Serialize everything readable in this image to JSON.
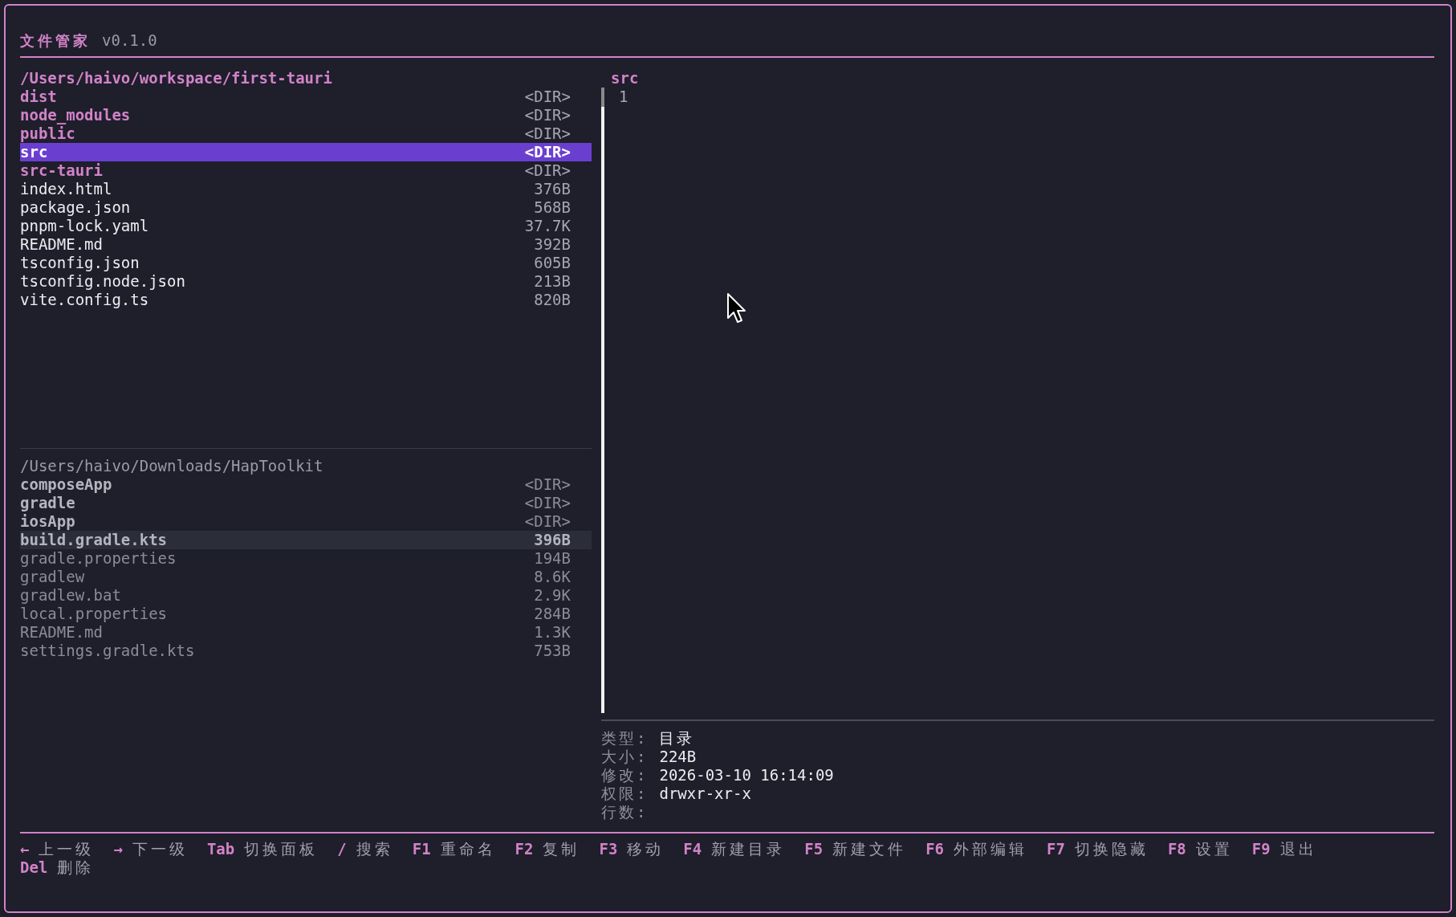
{
  "header": {
    "title": "文件管家",
    "version": "v0.1.0"
  },
  "panes": [
    {
      "path": "/Users/haivo/workspace/first-tauri",
      "active": true,
      "entries": [
        {
          "name": "dist",
          "kind": "dir",
          "size": "<DIR>",
          "selected": false
        },
        {
          "name": "node_modules",
          "kind": "dir",
          "size": "<DIR>",
          "selected": false
        },
        {
          "name": "public",
          "kind": "dir",
          "size": "<DIR>",
          "selected": false
        },
        {
          "name": "src",
          "kind": "dir",
          "size": "<DIR>",
          "selected": true
        },
        {
          "name": "src-tauri",
          "kind": "dir",
          "size": "<DIR>",
          "selected": false
        },
        {
          "name": "index.html",
          "kind": "file",
          "size": "376B",
          "selected": false
        },
        {
          "name": "package.json",
          "kind": "file",
          "size": "568B",
          "selected": false
        },
        {
          "name": "pnpm-lock.yaml",
          "kind": "file",
          "size": "37.7K",
          "selected": false
        },
        {
          "name": "README.md",
          "kind": "file",
          "size": "392B",
          "selected": false
        },
        {
          "name": "tsconfig.json",
          "kind": "file",
          "size": "605B",
          "selected": false
        },
        {
          "name": "tsconfig.node.json",
          "kind": "file",
          "size": "213B",
          "selected": false
        },
        {
          "name": "vite.config.ts",
          "kind": "file",
          "size": "820B",
          "selected": false
        }
      ]
    },
    {
      "path": "/Users/haivo/Downloads/HapToolkit",
      "active": false,
      "entries": [
        {
          "name": "composeApp",
          "kind": "dir",
          "size": "<DIR>",
          "selected": false
        },
        {
          "name": "gradle",
          "kind": "dir",
          "size": "<DIR>",
          "selected": false
        },
        {
          "name": "iosApp",
          "kind": "dir",
          "size": "<DIR>",
          "selected": false
        },
        {
          "name": "build.gradle.kts",
          "kind": "file",
          "size": "396B",
          "selected": true
        },
        {
          "name": "gradle.properties",
          "kind": "file",
          "size": "194B",
          "selected": false
        },
        {
          "name": "gradlew",
          "kind": "file",
          "size": "8.6K",
          "selected": false
        },
        {
          "name": "gradlew.bat",
          "kind": "file",
          "size": "2.9K",
          "selected": false
        },
        {
          "name": "local.properties",
          "kind": "file",
          "size": "284B",
          "selected": false
        },
        {
          "name": "README.md",
          "kind": "file",
          "size": "1.3K",
          "selected": false
        },
        {
          "name": "settings.gradle.kts",
          "kind": "file",
          "size": "753B",
          "selected": false
        }
      ]
    }
  ],
  "preview": {
    "title": "src",
    "line_numbers": [
      "1"
    ]
  },
  "info": [
    {
      "label": "类型:",
      "value": "目录"
    },
    {
      "label": "大小:",
      "value": "224B"
    },
    {
      "label": "修改:",
      "value": "2026-03-10 16:14:09"
    },
    {
      "label": "权限:",
      "value": "drwxr-xr-x"
    },
    {
      "label": "行数:"
    }
  ],
  "key_hint_lines": [
    [
      {
        "key": "←",
        "label": "上一级"
      },
      {
        "key": "→",
        "label": "下一级"
      },
      {
        "key": "Tab",
        "label": "切换面板"
      },
      {
        "key": "/",
        "label": "搜索"
      },
      {
        "key": "F1",
        "label": "重命名"
      },
      {
        "key": "F2",
        "label": "复制"
      },
      {
        "key": "F3",
        "label": "移动"
      },
      {
        "key": "F4",
        "label": "新建目录"
      },
      {
        "key": "F5",
        "label": "新建文件"
      },
      {
        "key": "F6",
        "label": "外部编辑"
      },
      {
        "key": "F7",
        "label": "切换隐藏"
      },
      {
        "key": "F8",
        "label": "设置"
      },
      {
        "key": "F9",
        "label": "退出"
      }
    ],
    [
      {
        "key": "Del",
        "label": "删除"
      }
    ]
  ]
}
